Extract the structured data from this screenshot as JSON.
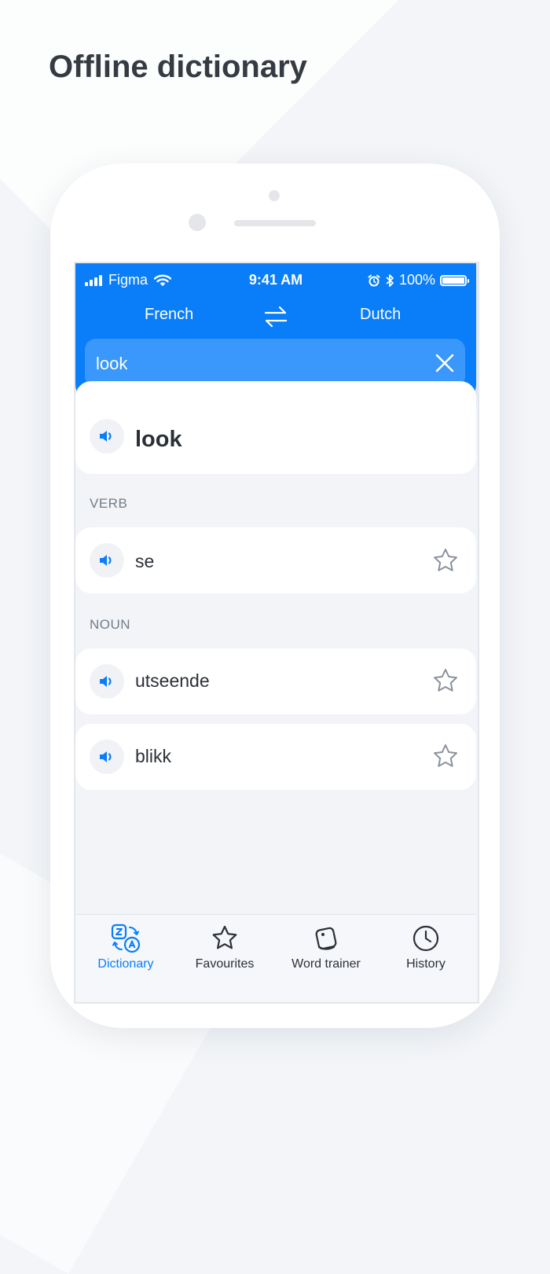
{
  "headline": "Offline dictionary",
  "status": {
    "carrier": "Figma",
    "time": "9:41 AM",
    "battery": "100%"
  },
  "languages": {
    "source": "French",
    "target": "Dutch"
  },
  "search": {
    "value": "look",
    "placeholder": ""
  },
  "main_word": "look",
  "sections": [
    {
      "label": "VERB",
      "entries": [
        {
          "word": "se"
        }
      ]
    },
    {
      "label": "NOUN",
      "entries": [
        {
          "word": "utseende"
        },
        {
          "word": "blikk"
        }
      ]
    }
  ],
  "tabs": [
    {
      "label": "Dictionary",
      "icon": "translate-icon",
      "active": true
    },
    {
      "label": "Favourites",
      "icon": "star-icon",
      "active": false
    },
    {
      "label": "Word trainer",
      "icon": "cards-icon",
      "active": false
    },
    {
      "label": "History",
      "icon": "clock-icon",
      "active": false
    }
  ],
  "colors": {
    "accent": "#0A7EF9",
    "search_bg": "#3A97FB",
    "text": "#2B3038",
    "section": "#717C89"
  }
}
